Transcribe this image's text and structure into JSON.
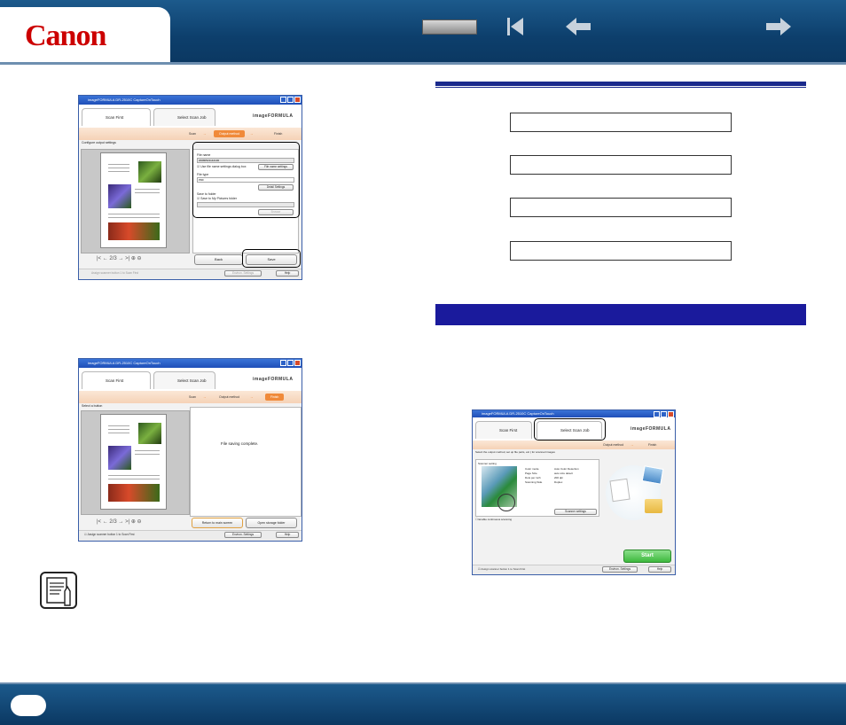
{
  "header": {
    "logo": "Canon",
    "nav_icons": [
      "blank-button",
      "first-page-icon",
      "back-arrow-icon",
      "forward-arrow-icon"
    ]
  },
  "screen1": {
    "title": "imageFORMULA DR-2510C CaptureOnTouch",
    "tab_scan_first": "Scan First",
    "tab_select_scan_job": "Select Scan Job",
    "brand": "imageFORMULA",
    "steps": [
      "Scan",
      "Output method",
      "Finish"
    ],
    "instruction": "Configure output settings",
    "file_name_label": "File name",
    "file_name_value": "20080521142100",
    "check_save_dialog": "Use file name settings dialog box",
    "file_name_settings": "File name settings",
    "file_type_label": "File type",
    "file_type_value": "PDF",
    "detail_settings": "Detail Settings",
    "save_folder_label": "Save to folder",
    "check_my_pictures": "Save to My Pictures folder",
    "browse": "Browse",
    "back": "Back",
    "save": "Save",
    "page_value": "2",
    "page_total": "/3",
    "status_assign": "Assign scanner button 1 to Scan First",
    "environ": "Environ. Settings",
    "help": "Help"
  },
  "screen2": {
    "title": "imageFORMULA DR-2510C CaptureOnTouch",
    "tab_scan_first": "Scan First",
    "tab_select_scan_job": "Select Scan Job",
    "brand": "imageFORMULA",
    "steps": [
      "Scan",
      "Output method",
      "Finish"
    ],
    "instruction": "Select a button",
    "message": "File saving complete.",
    "return_btn": "Return to main screen",
    "open_folder_btn": "Open storage folder",
    "page_value": "2",
    "page_total": "/3",
    "status_assign": "Assign scanner button 1 to Scan First",
    "environ": "Environ. Settings",
    "help": "Help"
  },
  "screen3": {
    "title": "imageFORMULA DR-2510C CaptureOnTouch",
    "tab_scan_first": "Scan First",
    "tab_select_scan_job": "Select Scan Job",
    "brand": "imageFORMULA",
    "steps": [
      "Output method",
      "Finish"
    ],
    "instruction": "Select the output method, set up file parts, etc.) for scanned images",
    "scanner_setting": "Scanner setting",
    "rows": [
      {
        "k": "Color mode",
        "v": "Auto Color Detection"
      },
      {
        "k": "Page Size",
        "v": "auto size detect"
      },
      {
        "k": "Dots per inch",
        "v": "200 dpi"
      },
      {
        "k": "Scanning Side",
        "v": "Duplex"
      }
    ],
    "scanner_settings_btn": "Scanner settings",
    "check_continuous": "Enable continuous scanning",
    "start": "Start",
    "status_assign": "Assign scanner button 1 to Scan First",
    "environ": "Environ. Settings",
    "help": "Help"
  }
}
